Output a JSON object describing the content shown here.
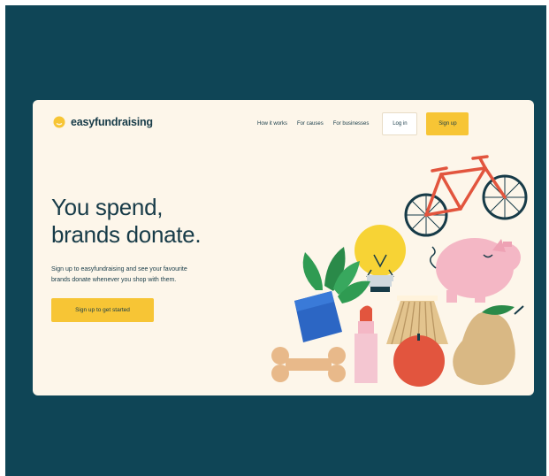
{
  "brand": {
    "name": "easyfundraising",
    "logo_icon": "sun-icon",
    "accent": "#f7c535",
    "background": "#0f4556"
  },
  "nav": {
    "links": [
      "How it works",
      "For causes",
      "For businesses"
    ],
    "login_label": "Log in",
    "signup_label": "Sign up"
  },
  "hero": {
    "title_line1": "You spend,",
    "title_line2": "brands donate.",
    "subtitle_line1": "Sign up to easyfundraising and see your favourite",
    "subtitle_line2": "brands donate whenever you shop with them.",
    "cta_label": "Sign up to get started"
  },
  "illustration_items": [
    "bicycle-icon",
    "lightbulb-icon",
    "piggy-bank-icon",
    "potted-plant-icon",
    "lipstick-icon",
    "lampshade-icon",
    "dog-bone-icon",
    "apple-icon",
    "pear-icon"
  ]
}
